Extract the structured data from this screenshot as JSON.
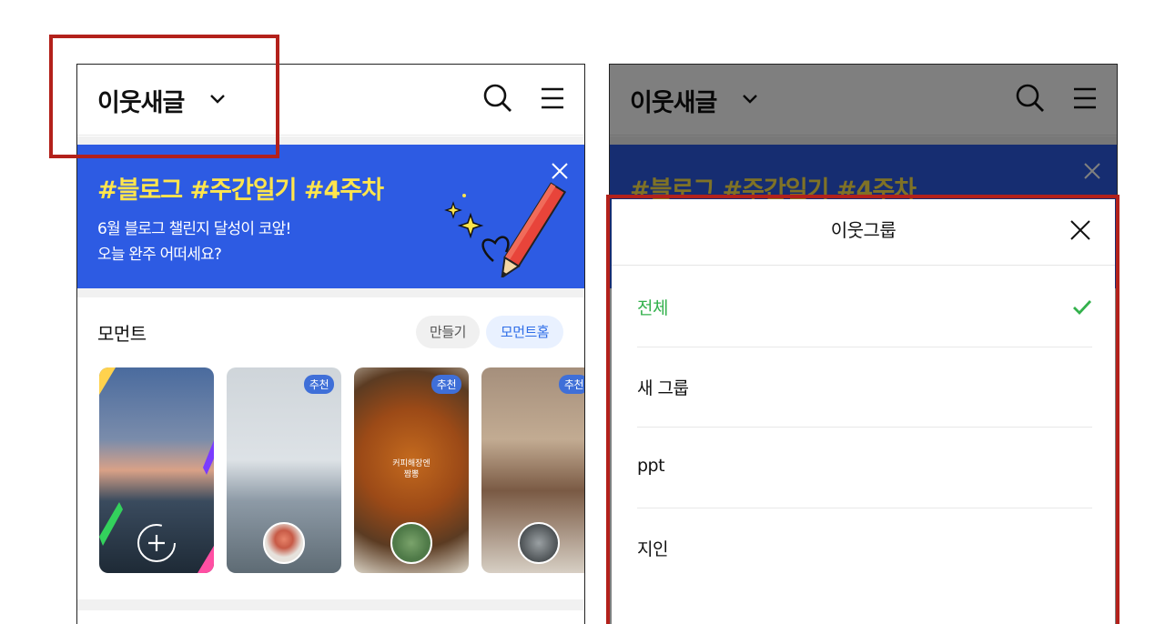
{
  "left_phone": {
    "header": {
      "title": "이웃새글"
    },
    "banner": {
      "hashtags": "#블로그 #주간일기 #4주차",
      "line1": "6월 블로그 챌린지 달성이 코앞!",
      "line2": "오늘 완주 어떠세요?"
    },
    "moment": {
      "title": "모먼트",
      "make_label": "만들기",
      "home_label": "모먼트홈",
      "cards": [
        {
          "badge": "",
          "caption": ""
        },
        {
          "badge": "추천",
          "caption": ""
        },
        {
          "badge": "추천",
          "caption": "커피해장엔\n짬뽕"
        },
        {
          "badge": "추천",
          "caption": ""
        }
      ]
    }
  },
  "right_phone": {
    "header": {
      "title": "이웃새글"
    },
    "banner": {
      "hashtags": "#블로그 #주간일기 #4주차"
    },
    "sheet": {
      "title": "이웃그룹",
      "items": [
        {
          "label": "전체",
          "selected": true
        },
        {
          "label": "새 그룹",
          "selected": false
        },
        {
          "label": "ppt",
          "selected": false
        },
        {
          "label": "지인",
          "selected": false
        }
      ]
    }
  },
  "colors": {
    "banner_blue": "#2d5be3",
    "banner_yellow": "#ffe54d",
    "selected_green": "#33b14c",
    "highlight_red": "#b3211b",
    "chip_blue_text": "#2f6ee8"
  },
  "icons": [
    "chevron-down-icon",
    "search-icon",
    "menu-icon",
    "close-icon",
    "check-icon",
    "plus-circle-icon",
    "pencil-illustration"
  ]
}
